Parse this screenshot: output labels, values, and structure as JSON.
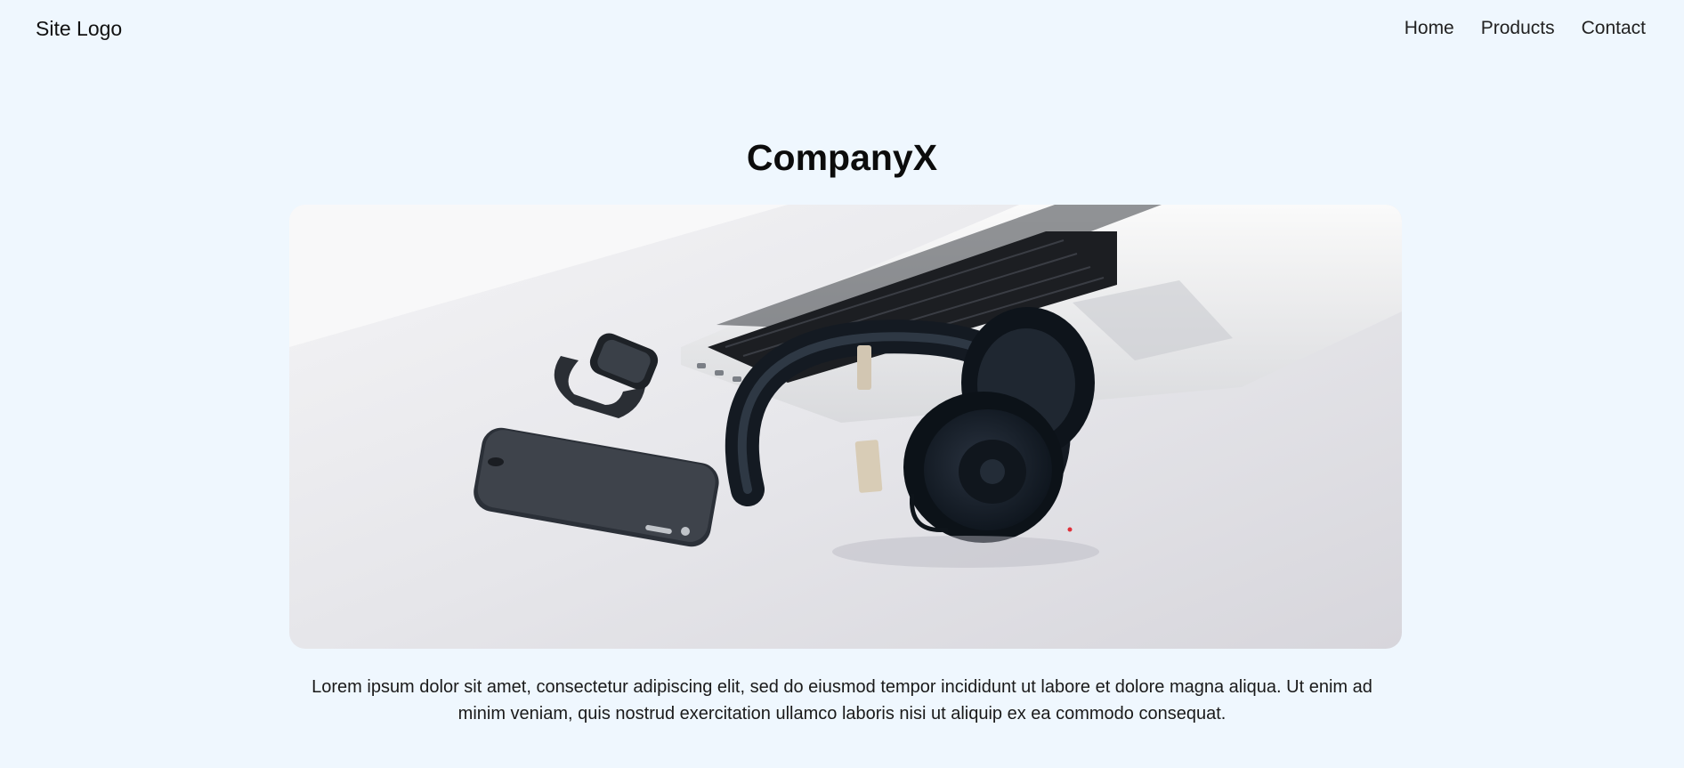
{
  "header": {
    "logo_text": "Site Logo",
    "nav": [
      {
        "label": "Home"
      },
      {
        "label": "Products"
      },
      {
        "label": "Contact"
      }
    ]
  },
  "main": {
    "title": "CompanyX",
    "description": "Lorem ipsum dolor sit amet, consectetur adipiscing elit, sed do eiusmod tempor incididunt ut labore et dolore magna aliqua. Ut enim ad minim veniam, quis nostrud exercitation ullamco laboris nisi ut aliquip ex ea commodo consequat."
  },
  "colors": {
    "page_background": "#eff7fe",
    "text": "#111111"
  }
}
